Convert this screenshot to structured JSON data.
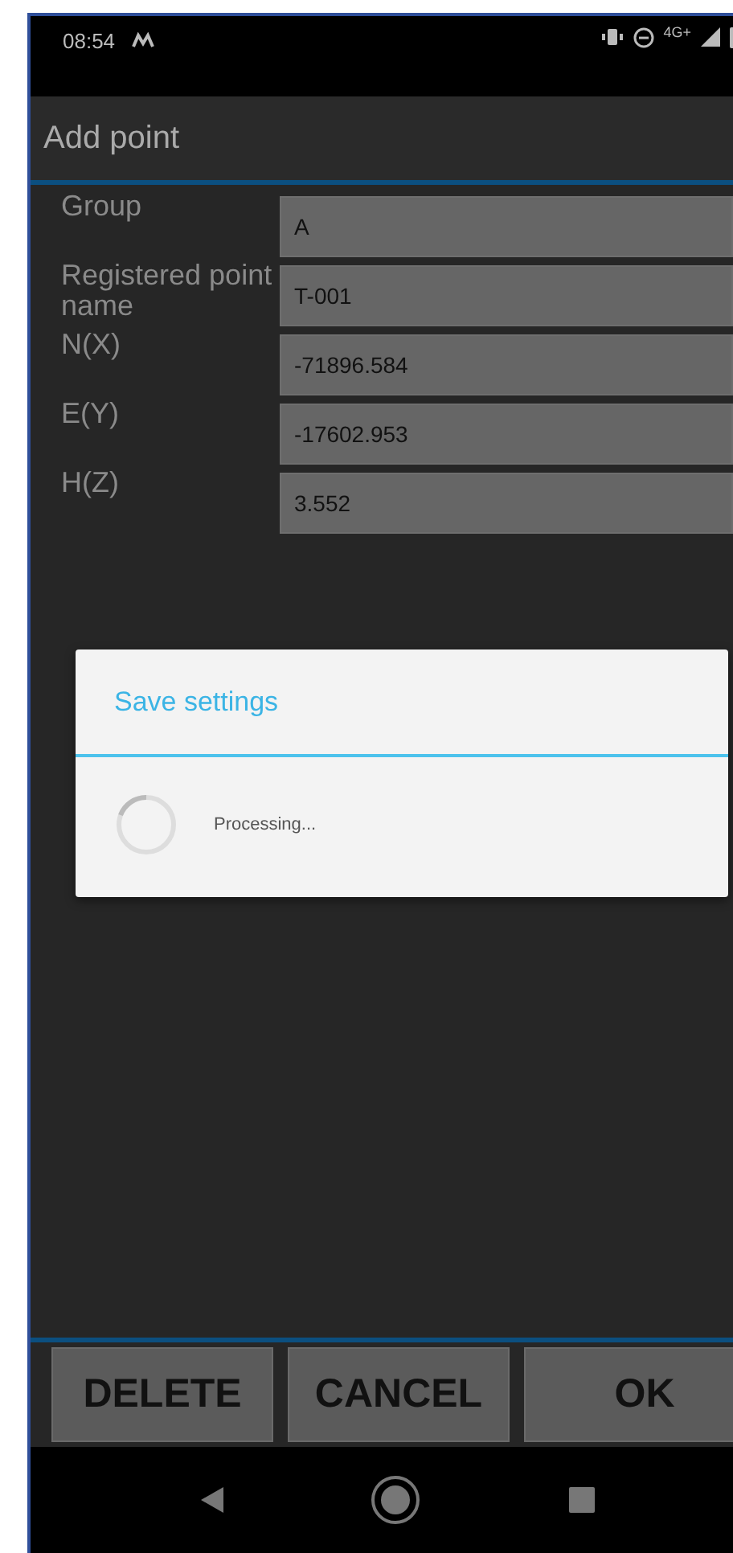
{
  "status_bar": {
    "time": "08:54",
    "network": "4G+"
  },
  "title": "Add point",
  "fields": [
    {
      "label": "Group",
      "value": "A"
    },
    {
      "label": "Registered point name",
      "value": "T-001"
    },
    {
      "label": "N(X)",
      "value": "-71896.584"
    },
    {
      "label": "E(Y)",
      "value": "-17602.953"
    },
    {
      "label": "H(Z)",
      "value": "3.552"
    }
  ],
  "dialog": {
    "title": "Save settings",
    "message": "Processing..."
  },
  "buttons": [
    "DELETE",
    "CANCEL",
    "OK"
  ]
}
